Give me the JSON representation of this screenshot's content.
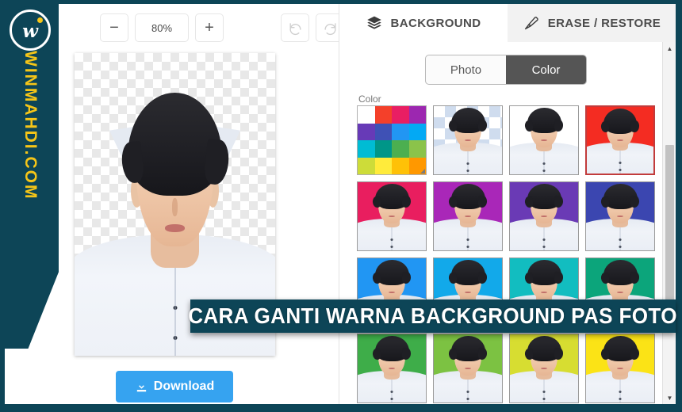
{
  "brand": {
    "logo_icon": "wi-monogram-logo",
    "site_text": "WINMAHDI.COM",
    "accent_color": "#f5c518",
    "frame_color": "#0d4557"
  },
  "editor": {
    "toolbar": {
      "zoom_out_label": "−",
      "zoom_value": "80%",
      "zoom_in_label": "+",
      "undo_icon": "undo-arrow-icon",
      "redo_icon": "redo-arrow-icon"
    },
    "canvas": {
      "background_state": "transparent-checkerboard",
      "subject": "portrait-photo"
    },
    "download_button": {
      "label": "Download",
      "icon": "download-icon",
      "color": "#36a3f0"
    }
  },
  "panel": {
    "tabs": [
      {
        "label": "BACKGROUND",
        "icon": "layers-icon",
        "active": true
      },
      {
        "label": "ERASE / RESTORE",
        "icon": "brush-icon",
        "active": false
      }
    ],
    "mode_toggle": {
      "options": [
        "Photo",
        "Color"
      ],
      "selected": "Color"
    },
    "section_label": "Color",
    "palette": {
      "name": "color-picker-swatch",
      "colors": [
        "#ffffff",
        "#f4402a",
        "#e91e63",
        "#9c27b0",
        "#673ab7",
        "#3f51b5",
        "#2196f3",
        "#03a9f4",
        "#00bcd4",
        "#009688",
        "#4caf50",
        "#8bc34a",
        "#cddc39",
        "#ffeb3b",
        "#ffc107",
        "#ff9800"
      ]
    },
    "swatches": [
      {
        "name": "transparent",
        "color": "transparent",
        "selected": false
      },
      {
        "name": "white",
        "color": "#ffffff",
        "selected": false
      },
      {
        "name": "red",
        "color": "#f42c22",
        "selected": true
      },
      {
        "name": "pink",
        "color": "#e91e5f",
        "selected": false
      },
      {
        "name": "magenta",
        "color": "#a927b8",
        "selected": false
      },
      {
        "name": "purple",
        "color": "#6a3ab5",
        "selected": false
      },
      {
        "name": "indigo",
        "color": "#3b46b0",
        "selected": false
      },
      {
        "name": "blue",
        "color": "#2196f3",
        "selected": false
      },
      {
        "name": "light-blue",
        "color": "#12a9ea",
        "selected": false
      },
      {
        "name": "cyan",
        "color": "#12bdc0",
        "selected": false
      },
      {
        "name": "teal",
        "color": "#0ca57b",
        "selected": false
      },
      {
        "name": "green",
        "color": "#3ead49",
        "selected": false
      },
      {
        "name": "light-green",
        "color": "#7cc242",
        "selected": false
      },
      {
        "name": "yellow-green",
        "color": "#d7dd31",
        "selected": false
      },
      {
        "name": "yellow",
        "color": "#fbe316",
        "selected": false
      }
    ],
    "scrollbar": {
      "up_arrow": "▲",
      "down_arrow": "▼"
    }
  },
  "banner": {
    "text": "CARA GANTI WARNA BACKGROUND PAS FOTO",
    "background_color": "#0d4557"
  }
}
